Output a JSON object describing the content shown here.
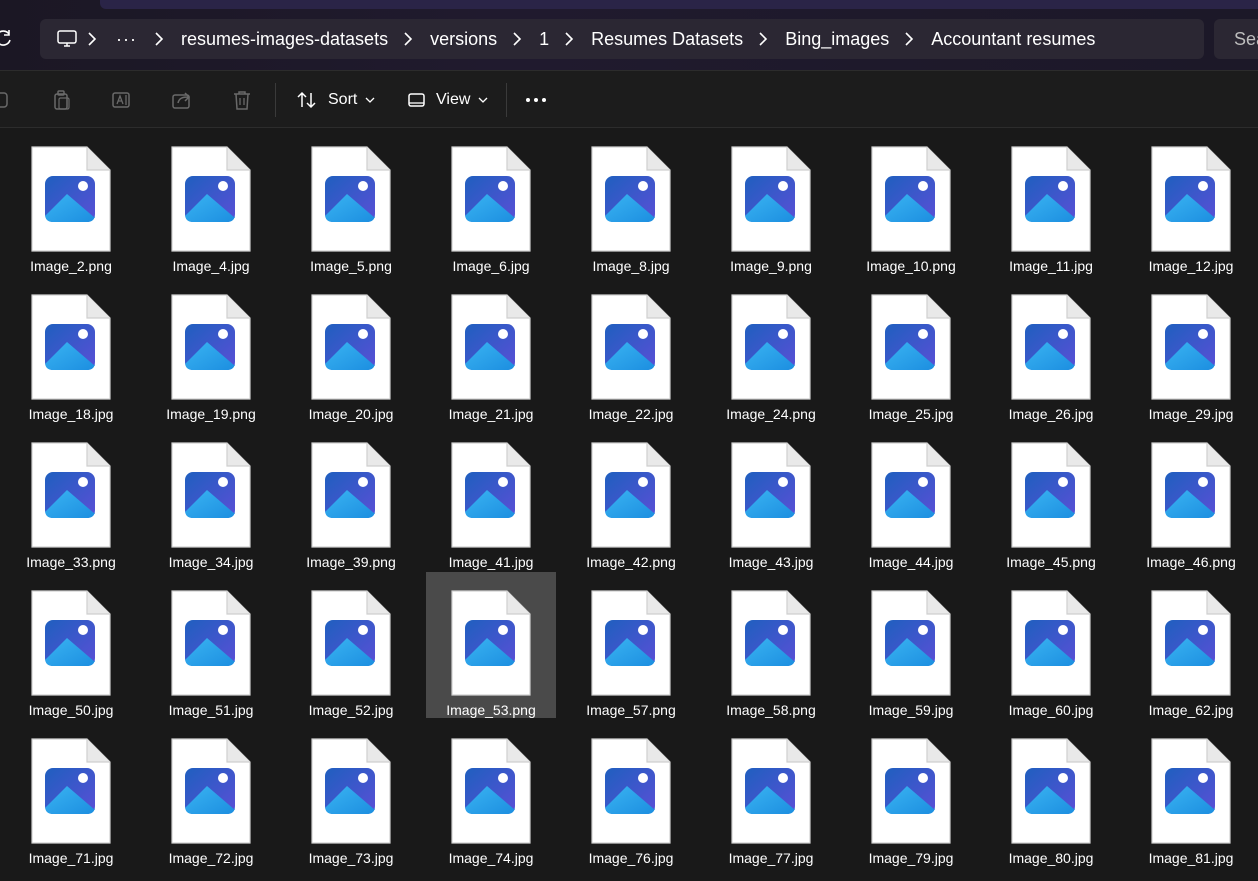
{
  "address": {
    "overflow_label": "···",
    "crumbs": [
      "resumes-images-datasets",
      "versions",
      "1",
      "Resumes Datasets",
      "Bing_images",
      "Accountant resumes"
    ]
  },
  "search": {
    "placeholder": "Search Accountant resumes",
    "visible_text": "Sea"
  },
  "commandbar": {
    "sort_label": "Sort",
    "view_label": "View",
    "more_label": "···",
    "icons": [
      "new-icon",
      "copy-icon",
      "rename-icon",
      "share-icon",
      "delete-icon",
      "sort-icon",
      "view-icon",
      "more-icon"
    ]
  },
  "files": [
    "Image_2.png",
    "Image_4.jpg",
    "Image_5.png",
    "Image_6.jpg",
    "Image_8.jpg",
    "Image_9.png",
    "Image_10.png",
    "Image_11.jpg",
    "Image_12.jpg",
    "Image_18.jpg",
    "Image_19.png",
    "Image_20.jpg",
    "Image_21.jpg",
    "Image_22.jpg",
    "Image_24.png",
    "Image_25.jpg",
    "Image_26.jpg",
    "Image_29.jpg",
    "Image_33.png",
    "Image_34.jpg",
    "Image_39.png",
    "Image_41.jpg",
    "Image_42.png",
    "Image_43.jpg",
    "Image_44.jpg",
    "Image_45.png",
    "Image_46.png",
    "Image_50.jpg",
    "Image_51.jpg",
    "Image_52.jpg",
    "Image_53.png",
    "Image_57.png",
    "Image_58.png",
    "Image_59.jpg",
    "Image_60.jpg",
    "Image_62.jpg",
    "Image_71.jpg",
    "Image_72.jpg",
    "Image_73.jpg",
    "Image_74.jpg",
    "Image_76.jpg",
    "Image_77.jpg",
    "Image_79.jpg",
    "Image_80.jpg",
    "Image_81.jpg"
  ],
  "selected_file": "Image_53.png",
  "file_icon": "image-file-icon",
  "colors": {
    "accent_dark": "#1f5fbf",
    "accent_light": "#3ab4f2",
    "selection": "#4a4a4a",
    "background": "#191919"
  }
}
